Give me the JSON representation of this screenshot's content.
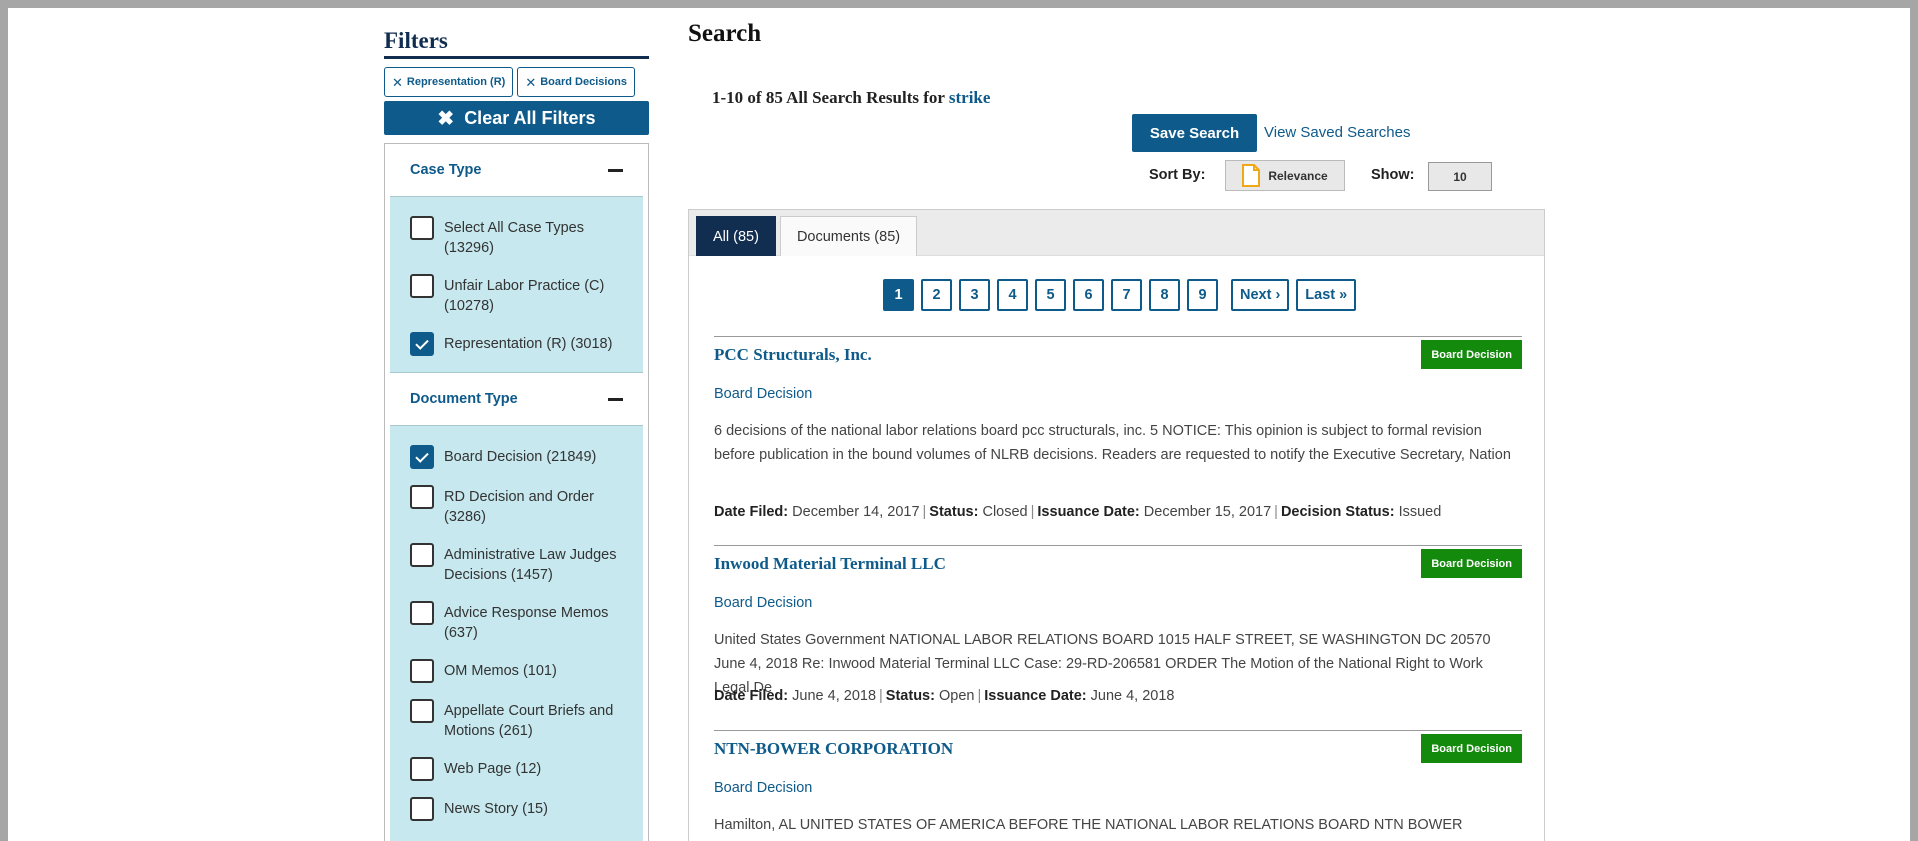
{
  "sidebar": {
    "title": "Filters",
    "chips": [
      "Representation (R)",
      "Board Decisions"
    ],
    "clear_label": "Clear All Filters",
    "case_type": {
      "title": "Case Type",
      "options": [
        {
          "label": "Select All Case Types (13296)",
          "checked": false
        },
        {
          "label": "Unfair Labor Practice (C) (10278)",
          "checked": false
        },
        {
          "label": "Representation (R) (3018)",
          "checked": true
        }
      ]
    },
    "document_type": {
      "title": "Document Type",
      "options": [
        {
          "label": "Board Decision (21849)",
          "checked": true
        },
        {
          "label": "RD Decision and Order (3286)",
          "checked": false
        },
        {
          "label": "Administrative Law Judges Decisions (1457)",
          "checked": false
        },
        {
          "label": "Advice Response Memos (637)",
          "checked": false
        },
        {
          "label": "OM Memos (101)",
          "checked": false
        },
        {
          "label": "Appellate Court Briefs and Motions (261)",
          "checked": false
        },
        {
          "label": "Web Page (12)",
          "checked": false
        },
        {
          "label": "News Story (15)",
          "checked": false
        }
      ]
    }
  },
  "main": {
    "title": "Search",
    "summary_prefix": "1-10 of 85 All Search Results for",
    "search_term": "strike",
    "save_label": "Save Search",
    "saved_link": "View Saved Searches",
    "sort_label": "Sort By:",
    "sort_value": "Relevance",
    "show_label": "Show:",
    "show_value": "10",
    "tabs": [
      {
        "label": "All (85)",
        "active": true
      },
      {
        "label": "Documents (85)",
        "active": false
      }
    ],
    "pages": [
      "1",
      "2",
      "3",
      "4",
      "5",
      "6",
      "7",
      "8",
      "9"
    ],
    "current_page": "1",
    "next_label": "Next ›",
    "last_label": "Last »",
    "results": [
      {
        "title": "PCC Structurals, Inc.",
        "badge": "Board Decision",
        "type": "Board Decision",
        "snippet": "6 decisions of the national labor relations board pcc structurals, inc. 5 NOTICE: This opinion is subject to formal revision before publication in the bound volumes of NLRB decisions. Readers are requested to notify the Executive Secretary, Nation",
        "meta": [
          {
            "k": "Date Filed:",
            "v": "December 14, 2017"
          },
          {
            "k": "Status:",
            "v": "Closed"
          },
          {
            "k": "Issuance Date:",
            "v": "December 15, 2017"
          },
          {
            "k": "Decision Status:",
            "v": "Issued"
          }
        ]
      },
      {
        "title": "Inwood Material Terminal LLC",
        "badge": "Board Decision",
        "type": "Board Decision",
        "snippet": "United States Government NATIONAL LABOR RELATIONS BOARD 1015 HALF STREET, SE WASHINGTON DC 20570 June 4, 2018 Re: Inwood Material Terminal LLC Case: 29-RD-206581 ORDER The Motion of the National Right to Work Legal De",
        "meta": [
          {
            "k": "Date Filed:",
            "v": "June 4, 2018"
          },
          {
            "k": "Status:",
            "v": "Open"
          },
          {
            "k": "Issuance Date:",
            "v": "June 4, 2018"
          }
        ]
      },
      {
        "title": "NTN-BOWER CORPORATION",
        "badge": "Board Decision",
        "type": "Board Decision",
        "snippet": "Hamilton, AL UNITED STATES OF AMERICA BEFORE THE NATIONAL LABOR RELATIONS BOARD NTN BOWER",
        "meta": []
      }
    ]
  }
}
